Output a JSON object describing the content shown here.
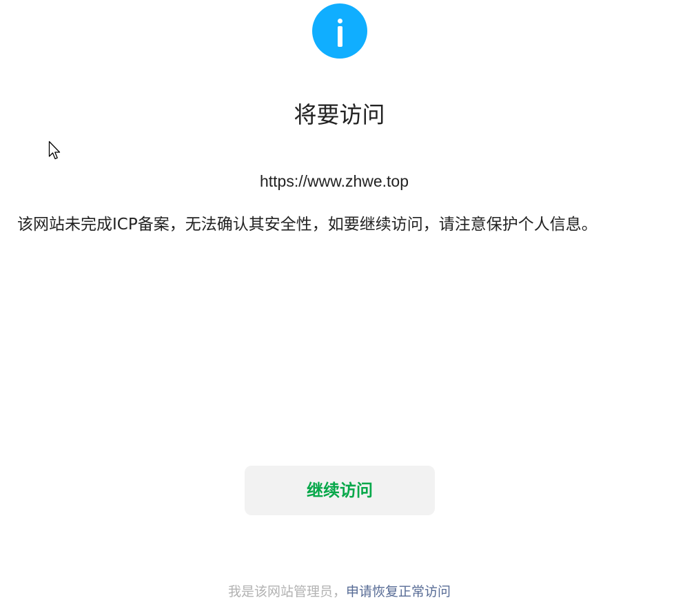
{
  "icon": {
    "name": "info-icon",
    "color": "#10aeff"
  },
  "title": "将要访问",
  "url": "https://www.zhwe.top",
  "warning": "该网站未完成ICP备案，无法确认其安全性，如要继续访问，请注意保护个人信息。",
  "continue_button": {
    "label": "继续访问",
    "color": "#07a84a"
  },
  "footer": {
    "prefix": "我是该网站管理员，",
    "link_label": "申请恢复正常访问",
    "link_color": "#576b95"
  }
}
